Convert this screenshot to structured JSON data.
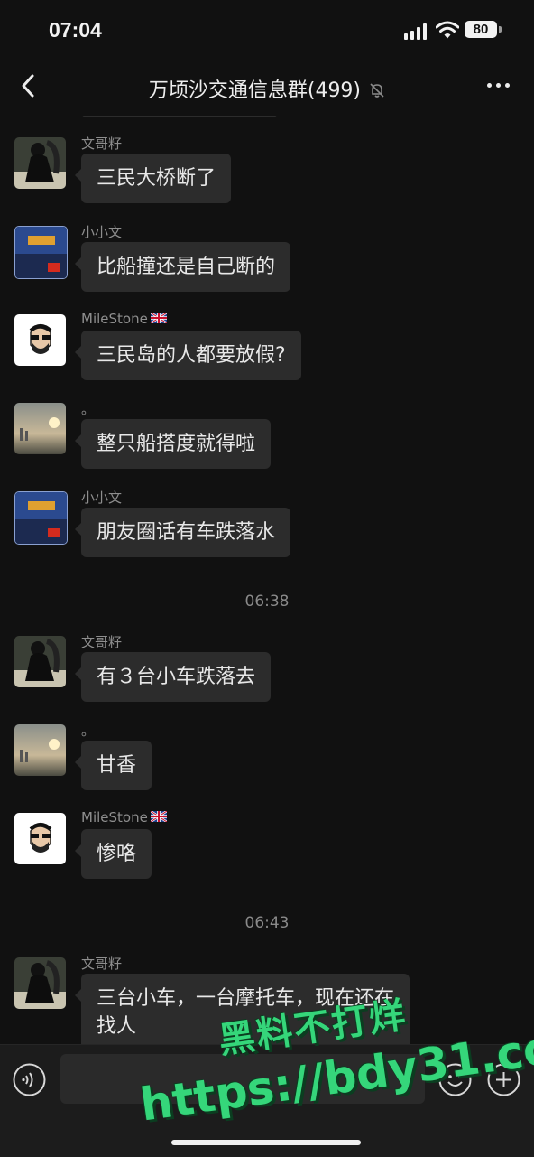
{
  "status_bar": {
    "time": "07:04",
    "battery": "80"
  },
  "header": {
    "title": "万顷沙交通信息群(499)"
  },
  "messages": [
    {
      "sender": "文哥籽",
      "text": "三民大桥断了"
    },
    {
      "sender": "小小文",
      "text": "比船撞还是自己断的"
    },
    {
      "sender": "MileStone",
      "text": "三民岛的人都要放假?"
    },
    {
      "sender": "。",
      "text": "整只船搭度就得啦"
    },
    {
      "sender": "小小文",
      "text": "朋友圈话有车跌落水"
    },
    {
      "sender": "文哥籽",
      "text": "有３台小车跌落去"
    },
    {
      "sender": "。",
      "text": "甘香"
    },
    {
      "sender": "MileStone",
      "text": "惨咯"
    },
    {
      "sender": "文哥籽",
      "text": "三台小车，一台摩托车，现在还在\n找人"
    }
  ],
  "timestamps": [
    "06:38",
    "06:43"
  ],
  "watermark": {
    "line1": "黑料不打烊",
    "line2": "https://bdy31.co"
  },
  "icons": {
    "back": "chevron-left-icon",
    "mute": "bell-off-icon",
    "more": "more-icon",
    "voice": "voice-icon",
    "emoji": "emoji-icon",
    "plus": "plus-icon",
    "flag": "uk-flag-icon"
  },
  "colors": {
    "background": "#111111",
    "bubble": "#2c2c2c",
    "watermark": "#35d67a"
  }
}
